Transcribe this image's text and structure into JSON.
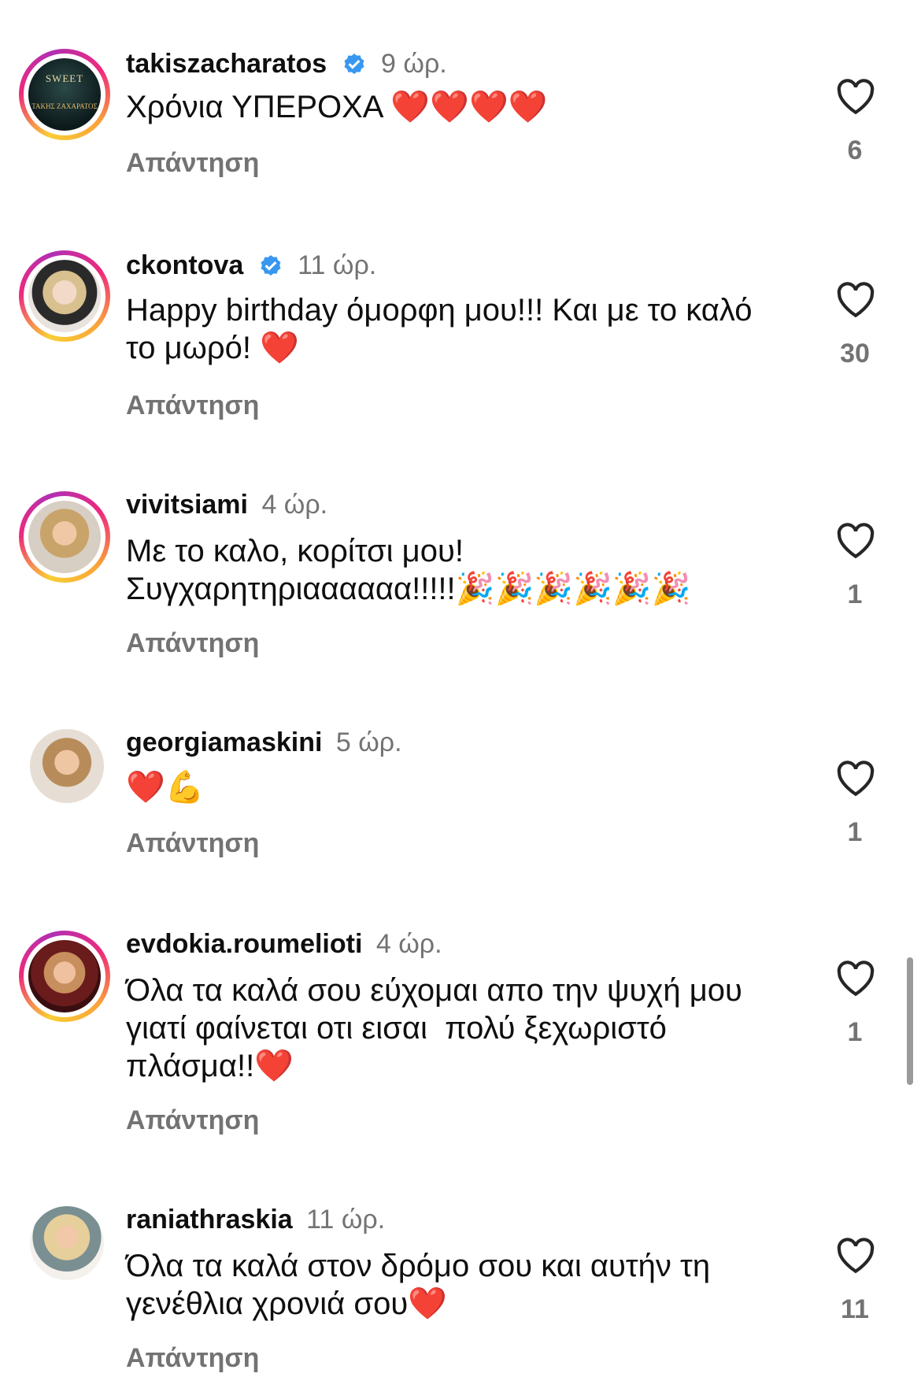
{
  "comments": [
    {
      "username": "takiszacharatos",
      "verified": true,
      "time": "9 ώρ.",
      "text": "Χρόνια ΥΠΕΡΟΧΑ ❤️❤️❤️❤️",
      "reply": "Απάντηση",
      "likes": "6",
      "avatar_text_1": "SWEET",
      "avatar_text_2": "ΤΑΚΗΣ ΖΑΧΑΡΑΤΟΣ"
    },
    {
      "username": "ckontova",
      "verified": true,
      "time": "11 ώρ.",
      "text": "Happy birthday όμορφη μου!!! Και με το καλό το μωρό! ❤️",
      "reply": "Απάντηση",
      "likes": "30"
    },
    {
      "username": "vivitsiami",
      "verified": false,
      "time": "4 ώρ.",
      "text": "Με το καλο, κορίτσι μου!\nΣυγχαρητηριαααααα!!!!!🎉🎉🎉🎉🎉🎉",
      "reply": "Απάντηση",
      "likes": "1"
    },
    {
      "username": "georgiamaskini",
      "verified": false,
      "time": "5 ώρ.",
      "text": "❤️💪",
      "reply": "Απάντηση",
      "likes": "1"
    },
    {
      "username": "evdokia.roumelioti",
      "verified": false,
      "time": "4 ώρ.",
      "text": "Όλα τα καλά σου εύχομαι απο την ψυχή μου γιατί φαίνεται οτι εισαι  πολύ ξεχωριστό πλάσμα!!❤️",
      "reply": "Απάντηση",
      "likes": "1"
    },
    {
      "username": "raniathraskia",
      "verified": false,
      "time": "11 ώρ.",
      "text": "Όλα τα καλά στον δρόμο σου και αυτήν τη γενέθλια χρονιά σου❤️",
      "reply": "Απάντηση",
      "likes": "11"
    }
  ],
  "icons": {
    "like": "heart-outline-icon",
    "verified": "verified-badge-icon"
  },
  "colors": {
    "secondary_text": "#737373",
    "verified_blue": "#3897f0",
    "primary_text": "#0f0f0f"
  }
}
